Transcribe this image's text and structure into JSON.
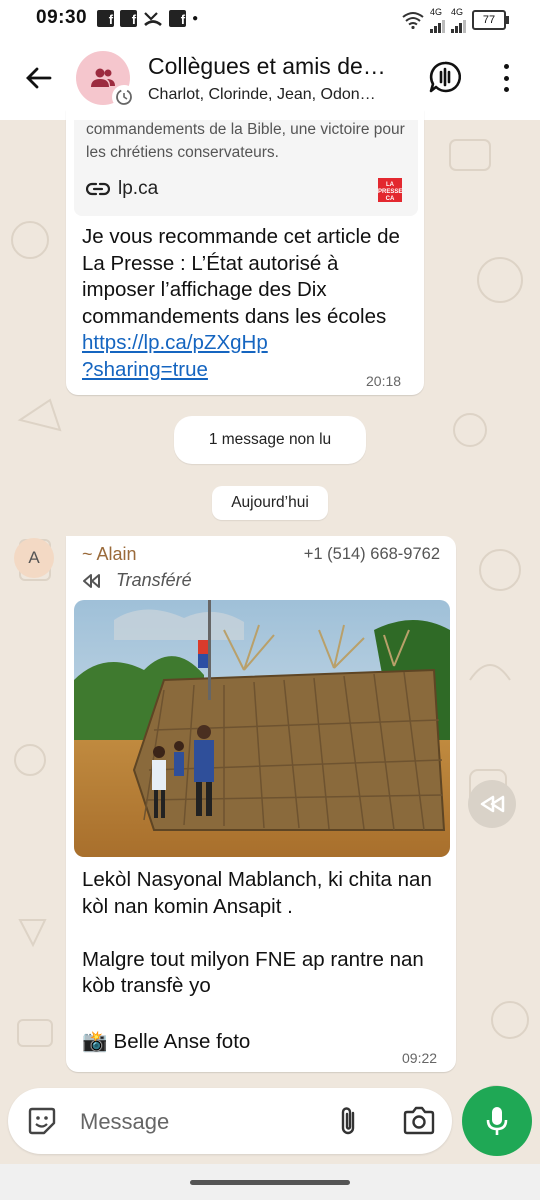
{
  "status_bar": {
    "time": "09:30",
    "battery": "77",
    "network_label": "4G"
  },
  "header": {
    "title": "Collègues et amis de…",
    "members": "Charlot, Clorinde, Jean, Odon…"
  },
  "message1": {
    "preview_description": "commandements de la Bible, une victoire pour les chrétiens conservateurs.",
    "preview_domain": "lp.ca",
    "logo_text": "LA PRESSE CA",
    "text": "Je vous recommande cet article de La Presse : L’État autorisé à imposer l’affichage des Dix commandements dans les écoles ",
    "link_line1": "https://lp.ca/pZXgHp",
    "link_line2": "?sharing=true",
    "time": "20:18"
  },
  "unread_label": "1 message non lu",
  "date_label": "Aujourd’hui",
  "message2": {
    "avatar_initial": "A",
    "sender_name": "~ Alain",
    "sender_phone": "+1 (514) 668-9762",
    "forwarded_label": "Transféré",
    "text": "Lekòl Nasyonal Mablanch, ki chita nan kòl nan komin Ansapit .\n\nMalgre tout milyon FNE ap rantre nan kòb transfè yo",
    "camera_emoji": "📸",
    "camera_caption": "Belle Anse foto",
    "time": "09:22"
  },
  "input": {
    "placeholder": "Message"
  },
  "colors": {
    "accent_green": "#1fa855",
    "chat_background": "#efe7dd",
    "link_blue": "#1565c0",
    "sender_name": "#9a6a3a"
  },
  "icons": [
    "back-arrow-icon",
    "group-icon",
    "clock-icon",
    "voice-call-icon",
    "more-vert-icon",
    "link-icon",
    "forward-icon",
    "share-forward-icon",
    "emoji-icon",
    "attach-icon",
    "camera-icon",
    "mic-icon"
  ]
}
